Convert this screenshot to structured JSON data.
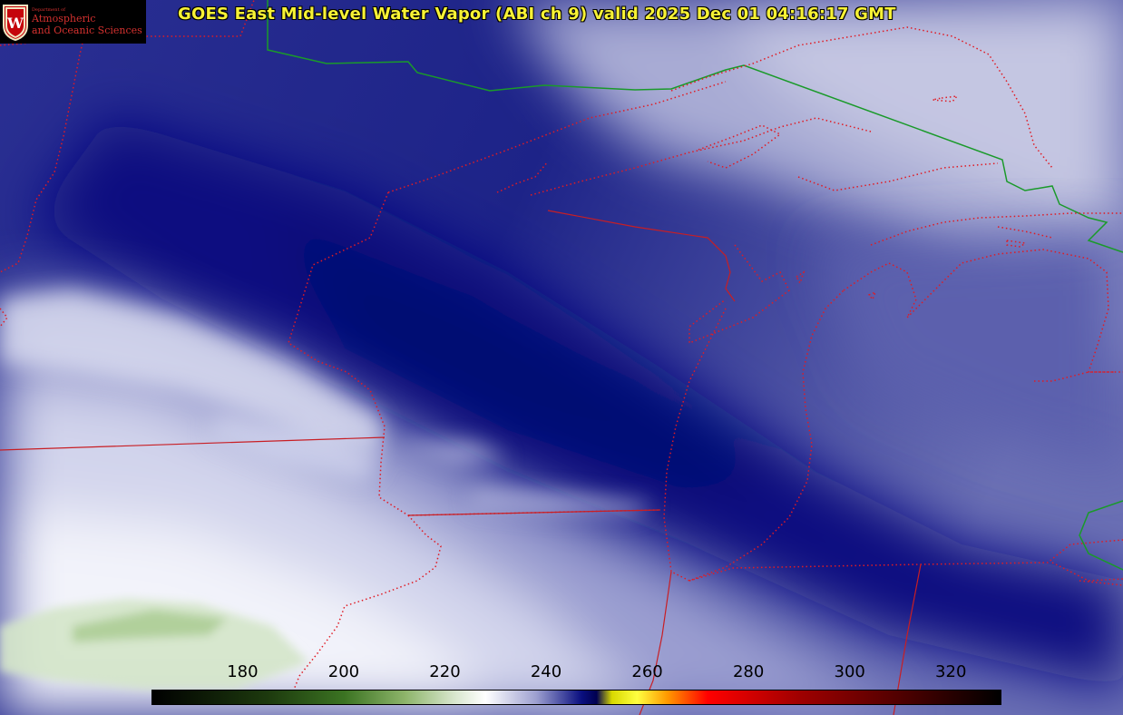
{
  "title": "GOES East Mid-level Water Vapor (ABI ch 9)  valid 2025 Dec 01 04:16:17 GMT",
  "logo": {
    "line1": "Department of",
    "line2": "Atmospheric",
    "line3": "and Oceanic Sciences",
    "crest_letter": "W"
  },
  "colorbar": {
    "tick_labels": [
      "180",
      "200",
      "220",
      "240",
      "260",
      "280",
      "300",
      "320"
    ],
    "range": [
      162,
      330
    ],
    "stops": [
      {
        "value": 162,
        "color": "#000000"
      },
      {
        "value": 185,
        "color": "#1d3a0e"
      },
      {
        "value": 200,
        "color": "#3b7322"
      },
      {
        "value": 212,
        "color": "#8db46a"
      },
      {
        "value": 222,
        "color": "#d9e7cf"
      },
      {
        "value": 228,
        "color": "#ffffff"
      },
      {
        "value": 238,
        "color": "#9da0d0"
      },
      {
        "value": 247,
        "color": "#0a0f80"
      },
      {
        "value": 250,
        "color": "#000050"
      },
      {
        "value": 253,
        "color": "#d8d800"
      },
      {
        "value": 258,
        "color": "#ffff40"
      },
      {
        "value": 264,
        "color": "#ff9900"
      },
      {
        "value": 272,
        "color": "#ff0000"
      },
      {
        "value": 290,
        "color": "#a00000"
      },
      {
        "value": 310,
        "color": "#500000"
      },
      {
        "value": 330,
        "color": "#000000"
      }
    ]
  },
  "colors": {
    "state_border": "#e01b24",
    "country_border": "#1a9a2a",
    "title_text": "#f7f235"
  }
}
